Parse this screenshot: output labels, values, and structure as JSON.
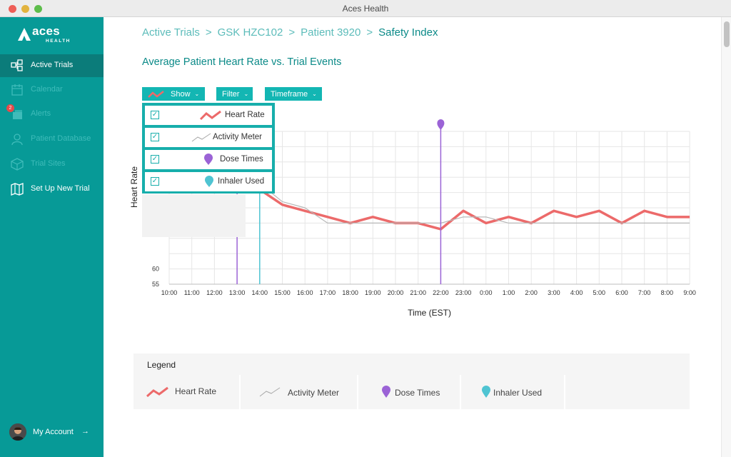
{
  "window": {
    "title": "Aces Health"
  },
  "brand": {
    "name": "aces",
    "sub": "HEALTH"
  },
  "sidebar": {
    "items": [
      {
        "label": "Active Trials",
        "icon": "trials-icon"
      },
      {
        "label": "Calendar",
        "icon": "calendar-icon"
      },
      {
        "label": "Alerts",
        "icon": "alerts-icon",
        "badge": "2"
      },
      {
        "label": "Patient Database",
        "icon": "patient-icon"
      },
      {
        "label": "Trial Sites",
        "icon": "sites-icon"
      },
      {
        "label": "Set Up New Trial",
        "icon": "map-icon"
      }
    ],
    "account": {
      "label": "My Account",
      "arrow": "→"
    }
  },
  "breadcrumb": {
    "items": [
      "Active Trials",
      "GSK HZC102",
      "Patient 3920"
    ],
    "current": "Safety Index",
    "separator": ">"
  },
  "chart_title": "Average Patient Heart Rate vs. Trial Events",
  "controls": {
    "show": "Show",
    "filter": "Filter",
    "timeframe": "Timeframe",
    "chevron": "⌄"
  },
  "show_menu": {
    "check": "✓",
    "items": [
      "Heart Rate",
      "Activity Meter",
      "Dose Times",
      "Inhaler Used"
    ]
  },
  "colors": {
    "accent": "#079a97",
    "heart_rate": "#ec6a6a",
    "activity": "#b8b8b8",
    "dose": "#9b63d6",
    "inhaler": "#4fc4d2"
  },
  "chart_data": {
    "type": "line",
    "x": [
      "10:00",
      "11:00",
      "12:00",
      "13:00",
      "14:00",
      "15:00",
      "16:00",
      "17:00",
      "18:00",
      "19:00",
      "20:00",
      "21:00",
      "22:00",
      "23:00",
      "0:00",
      "1:00",
      "2:00",
      "3:00",
      "4:00",
      "5:00",
      "6:00",
      "7:00",
      "8:00",
      "9:00"
    ],
    "ylabel": "Heart Rate",
    "xlabel": "Time (EST)",
    "yticks": [
      55,
      60
    ],
    "ylim": [
      55,
      105
    ],
    "grid": true,
    "series": [
      {
        "name": "Heart Rate",
        "type": "line",
        "values": [
          null,
          null,
          null,
          null,
          null,
          null,
          null,
          null,
          null,
          null,
          null,
          null,
          null,
          null,
          null,
          null,
          null,
          null,
          null,
          null,
          null,
          null,
          null,
          null
        ],
        "partial_x": [
          "14:00",
          "15:00",
          "16:00",
          "17:00",
          "18:00",
          "19:00",
          "20:00",
          "21:00",
          "22:00",
          "23:00",
          "0:00",
          "1:00",
          "2:00",
          "3:00",
          "4:00",
          "5:00",
          "6:00",
          "7:00",
          "8:00",
          "9:00"
        ],
        "partial_values": [
          86,
          81,
          79,
          77,
          75,
          77,
          75,
          75,
          73,
          79,
          75,
          77,
          75,
          79,
          77,
          79,
          75,
          79,
          77,
          77
        ]
      },
      {
        "name": "Activity Meter",
        "type": "line",
        "partial_x": [
          "14:00",
          "15:00",
          "16:00",
          "17:00",
          "18:00",
          "19:00",
          "20:00",
          "21:00",
          "22:00",
          "23:00",
          "0:00",
          "1:00",
          "2:00",
          "3:00",
          "4:00",
          "5:00",
          "6:00",
          "7:00",
          "8:00",
          "9:00"
        ],
        "partial_values": [
          88,
          82,
          80,
          75,
          75,
          75,
          75,
          75,
          75,
          77,
          77,
          75,
          75,
          75,
          75,
          75,
          75,
          75,
          75,
          75
        ]
      },
      {
        "name": "Dose Times",
        "type": "event",
        "x": [
          "13:00",
          "22:00"
        ]
      },
      {
        "name": "Inhaler Used",
        "type": "event",
        "x": [
          "14:00"
        ]
      }
    ]
  },
  "legend": {
    "title": "Legend",
    "items": [
      "Heart Rate",
      "Activity Meter",
      "Dose Times",
      "Inhaler Used"
    ]
  }
}
